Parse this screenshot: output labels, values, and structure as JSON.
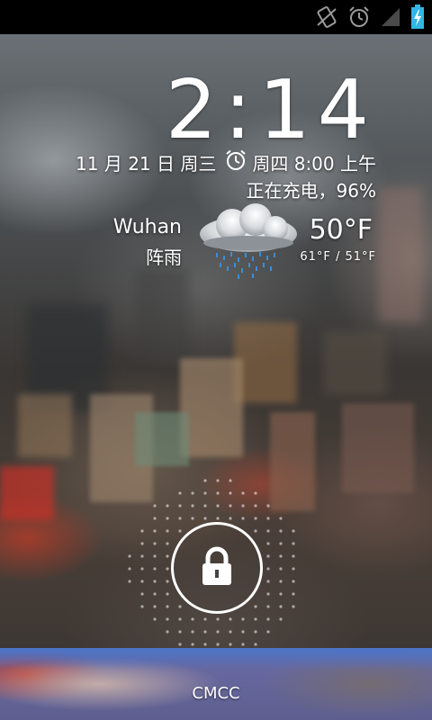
{
  "status_bar": {
    "icons": [
      "no-sim-icon",
      "alarm-icon",
      "signal-icon",
      "battery-charging-icon"
    ]
  },
  "clock": {
    "hour": "2",
    "separator": ":",
    "minute": "14"
  },
  "date": {
    "text": "11 月 21 日 周三",
    "alarm_icon": "alarm-clock-icon",
    "next_alarm": "周四 8:00 上午"
  },
  "charging": {
    "text": "正在充电，96%"
  },
  "weather": {
    "city": "Wuhan",
    "condition": "阵雨",
    "icon": "rain-cloud-icon",
    "temperature": "50°F",
    "range": "61°F / 51°F"
  },
  "lock": {
    "icon": "padlock-icon"
  },
  "carrier": {
    "label": "CMCC"
  },
  "colors": {
    "status_bar_bg": "#000000",
    "battery_accent": "#33b5e5",
    "text": "#ffffff"
  }
}
